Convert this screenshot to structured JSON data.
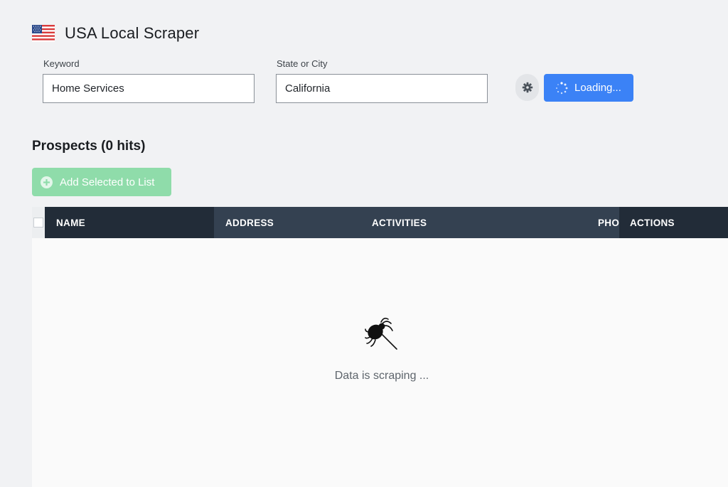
{
  "header": {
    "title": "USA Local Scraper",
    "flag_icon": "us-flag-icon"
  },
  "search": {
    "keyword_label": "Keyword",
    "keyword_value": "Home Services",
    "location_label": "State or City",
    "location_value": "California",
    "settings_icon": "gear-icon",
    "loading_label": "Loading...",
    "loading_icon": "spinner-icon",
    "accent_color": "#3b82f6"
  },
  "prospects": {
    "title": "Prospects (0 hits)",
    "add_button_label": "Add Selected to List",
    "add_button_icon": "plus-circle-icon",
    "add_button_color": "#8fdcaa"
  },
  "table": {
    "columns": [
      "NAME",
      "ADDRESS",
      "ACTIVITIES",
      "PHO",
      "ACTIONS"
    ]
  },
  "empty_state": {
    "icon": "spider-icon",
    "message": "Data is scraping ..."
  }
}
